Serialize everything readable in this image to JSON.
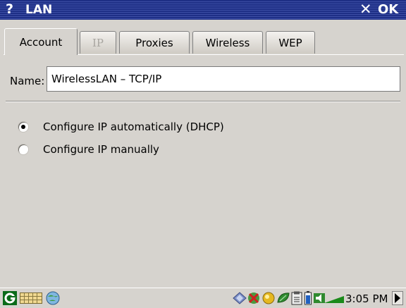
{
  "titlebar": {
    "help_label": "?",
    "title": "LAN",
    "close_label": "✕",
    "ok_label": "OK"
  },
  "tabs": [
    {
      "label": "Account",
      "state": "active"
    },
    {
      "label": "IP",
      "state": "disabled"
    },
    {
      "label": "Proxies",
      "state": "normal"
    },
    {
      "label": "Wireless",
      "state": "normal"
    },
    {
      "label": "WEP",
      "state": "normal"
    }
  ],
  "form": {
    "name_label": "Name:",
    "name_value": "WirelessLAN – TCP/IP",
    "radio_auto_label": "Configure IP automatically (DHCP)",
    "radio_auto_checked": true,
    "radio_manual_label": "Configure IP manually",
    "radio_manual_checked": false
  },
  "taskbar": {
    "clock": "3:05 PM",
    "icons": [
      "start-icon",
      "keyboard-icon",
      "network-globe-icon",
      "diamond-icon",
      "tools-icon",
      "sun-icon",
      "leaf-icon",
      "clipboard-icon",
      "battery-icon",
      "volume-icon",
      "network-cable-icon"
    ]
  },
  "colors": {
    "titlebar": "#1e2f86",
    "window_bg": "#d6d3ce",
    "disabled_text": "#a8a5a0"
  }
}
